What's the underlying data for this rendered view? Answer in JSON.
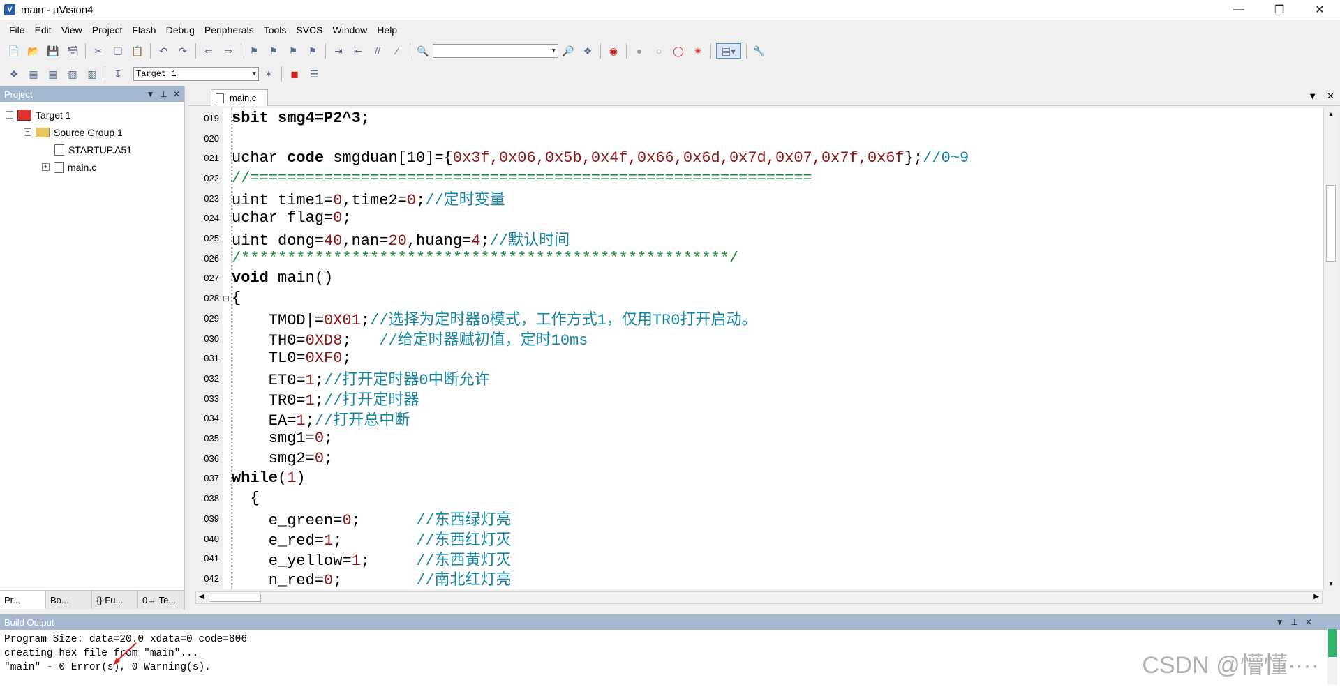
{
  "window": {
    "title": "main - µVision4"
  },
  "menu": [
    "File",
    "Edit",
    "View",
    "Project",
    "Flash",
    "Debug",
    "Peripherals",
    "Tools",
    "SVCS",
    "Window",
    "Help"
  ],
  "toolbar2": {
    "target_select": "Target 1"
  },
  "project_panel": {
    "title": "Project",
    "tree": {
      "target": "Target 1",
      "group": "Source Group 1",
      "files": [
        "STARTUP.A51",
        "main.c"
      ]
    },
    "tabs": [
      "Pr...",
      "Bo...",
      "{} Fu...",
      "0→ Te..."
    ]
  },
  "editor": {
    "tab_label": "main.c",
    "lines": [
      {
        "no": "019",
        "fold": ""
      },
      {
        "no": "020",
        "fold": ""
      },
      {
        "no": "021",
        "fold": ""
      },
      {
        "no": "022",
        "fold": ""
      },
      {
        "no": "023",
        "fold": ""
      },
      {
        "no": "024",
        "fold": ""
      },
      {
        "no": "025",
        "fold": ""
      },
      {
        "no": "026",
        "fold": ""
      },
      {
        "no": "027",
        "fold": ""
      },
      {
        "no": "028",
        "fold": "⊟"
      },
      {
        "no": "029",
        "fold": ""
      },
      {
        "no": "030",
        "fold": ""
      },
      {
        "no": "031",
        "fold": ""
      },
      {
        "no": "032",
        "fold": ""
      },
      {
        "no": "033",
        "fold": ""
      },
      {
        "no": "034",
        "fold": ""
      },
      {
        "no": "035",
        "fold": ""
      },
      {
        "no": "036",
        "fold": ""
      },
      {
        "no": "037",
        "fold": ""
      },
      {
        "no": "038",
        "fold": ""
      },
      {
        "no": "039",
        "fold": ""
      },
      {
        "no": "040",
        "fold": ""
      },
      {
        "no": "041",
        "fold": ""
      },
      {
        "no": "042",
        "fold": ""
      }
    ],
    "code": {
      "l019": "sbit smg4=P2^3;",
      "l021_a": "uchar ",
      "l021_b": "code",
      "l021_c": " smgduan[10]={",
      "l021_d": "0x3f,0x06,0x5b,0x4f,0x66,0x6d,0x7d,0x07,0x7f,0x6f",
      "l021_e": "};",
      "l021_f": "//0~9",
      "l022": "//=============================================================",
      "l023_a": "uint time1=",
      "l023_b": "0",
      "l023_c": ",time2=",
      "l023_d": "0",
      "l023_e": ";",
      "l023_f": "//定时变量",
      "l024_a": "uchar flag=",
      "l024_b": "0",
      "l024_c": ";",
      "l025_a": "uint dong=",
      "l025_b": "40",
      "l025_c": ",nan=",
      "l025_d": "20",
      "l025_e": ",huang=",
      "l025_f": "4",
      "l025_g": ";",
      "l025_h": "//默认时间",
      "l026": "/*****************************************************/",
      "l027_a": "void",
      "l027_b": " main()",
      "l028": "{",
      "l029_a": "    TMOD|=",
      "l029_b": "0X01",
      "l029_c": ";",
      "l029_d": "//选择为定时器0模式，工作方式1，仅用TR0打开启动。",
      "l030_a": "    TH0=",
      "l030_b": "0XD8",
      "l030_c": ";   ",
      "l030_d": "//给定时器赋初值，定时10ms",
      "l031_a": "    TL0=",
      "l031_b": "0XF0",
      "l031_c": ";",
      "l032_a": "    ET0=",
      "l032_b": "1",
      "l032_c": ";",
      "l032_d": "//打开定时器0中断允许",
      "l033_a": "    TR0=",
      "l033_b": "1",
      "l033_c": ";",
      "l033_d": "//打开定时器",
      "l034_a": "    EA=",
      "l034_b": "1",
      "l034_c": ";",
      "l034_d": "//打开总中断",
      "l035_a": "    smg1=",
      "l035_b": "0",
      "l035_c": ";",
      "l036_a": "    smg2=",
      "l036_b": "0",
      "l036_c": ";",
      "l037_a": "while",
      "l037_b": "(",
      "l037_c": "1",
      "l037_d": ")",
      "l038": "  {",
      "l039_a": "    e_green=",
      "l039_b": "0",
      "l039_c": ";      ",
      "l039_d": "//东西绿灯亮",
      "l040_a": "    e_red=",
      "l040_b": "1",
      "l040_c": ";        ",
      "l040_d": "//东西红灯灭",
      "l041_a": "    e_yellow=",
      "l041_b": "1",
      "l041_c": ";     ",
      "l041_d": "//东西黄灯灭",
      "l042_a": "    n_red=",
      "l042_b": "0",
      "l042_c": ";        ",
      "l042_d": "//南北红灯亮"
    }
  },
  "build_output": {
    "title": "Build Output",
    "lines": [
      "Program Size: data=20.0 xdata=0 code=806",
      "creating hex file from \"main\"...",
      "\"main\" - 0 Error(s), 0 Warning(s)."
    ]
  },
  "watermark": "CSDN @懵懂····"
}
